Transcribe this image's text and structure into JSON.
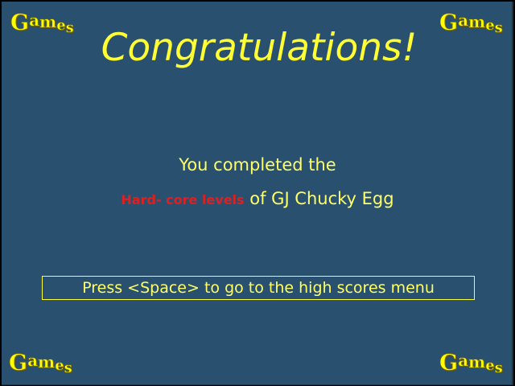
{
  "logo": {
    "letters": [
      "G",
      "a",
      "m",
      "e",
      "s"
    ]
  },
  "title": "Congratulations!",
  "message": {
    "line1": "You completed the",
    "difficulty": "Hard- core levels",
    "rest": "of GJ Chucky Egg"
  },
  "prompt": "Press <Space> to go to the high scores menu",
  "colors": {
    "background": "#2a5070",
    "text": "#ffff66",
    "difficulty": "#e02020",
    "logo": "#ffff00"
  }
}
